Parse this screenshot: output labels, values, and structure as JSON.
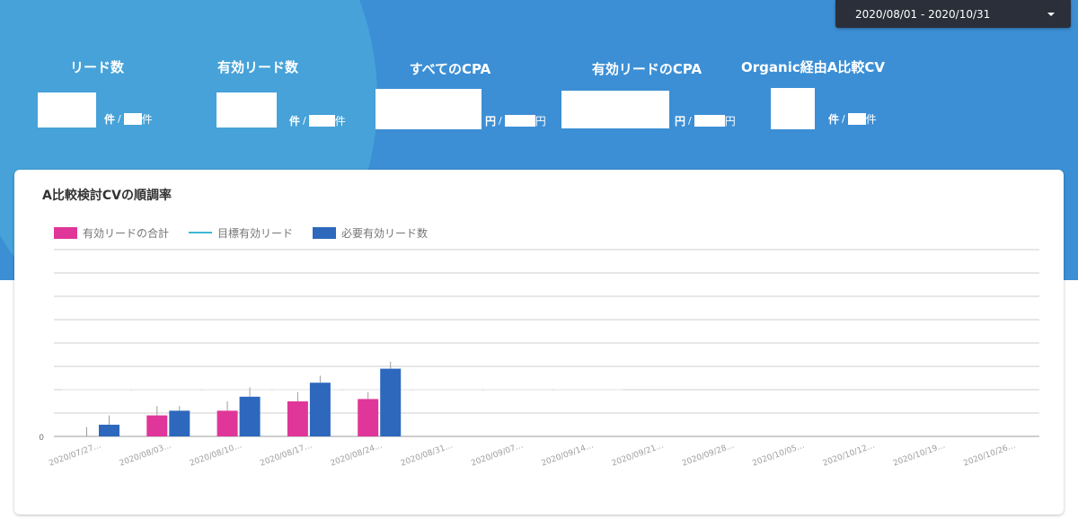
{
  "header": {
    "date_range": "2020/08/01 - 2020/10/31"
  },
  "metrics": [
    {
      "title": "リード数",
      "unit": "件",
      "sep": "/",
      "unit2": "件"
    },
    {
      "title": "有効リード数",
      "unit": "件",
      "sep": "/",
      "unit2": "件"
    },
    {
      "title": "すべてのCPA",
      "unit": "円",
      "sep": "/",
      "unit2": "円"
    },
    {
      "title": "有効リードのCPA",
      "unit": "円",
      "sep": "/",
      "unit2": "円"
    },
    {
      "title": "Organic経由A比較CV",
      "unit": "件",
      "sep": "/",
      "unit2": "件"
    }
  ],
  "colors": {
    "hero": "#3c8fd5",
    "hero_blob": "#46a2d8",
    "series_total": "#e0369a",
    "series_target": "#3db7d6",
    "series_required": "#2d68bd"
  },
  "chart_data": {
    "type": "bar",
    "title": "A比較検討CVの順調率",
    "categories": [
      "2020/07/27…",
      "2020/08/03…",
      "2020/08/10…",
      "2020/08/17…",
      "2020/08/24…",
      "2020/08/31…",
      "2020/09/07…",
      "2020/09/14…",
      "2020/09/21…",
      "2020/09/28…",
      "2020/10/05…",
      "2020/10/12…",
      "2020/10/19…",
      "2020/10/26…"
    ],
    "series": [
      {
        "name": "有効リードの合計",
        "kind": "bar",
        "values": [
          0,
          9,
          11,
          15,
          16,
          null,
          null,
          null,
          null,
          null,
          null,
          null,
          null,
          null
        ]
      },
      {
        "name": "目標有効リード",
        "kind": "line",
        "values": [
          20,
          20,
          20,
          20,
          20,
          20,
          20,
          20,
          null,
          null,
          null,
          null,
          null,
          null
        ]
      },
      {
        "name": "必要有効リード数",
        "kind": "bar",
        "values": [
          5,
          11,
          17,
          23,
          29,
          null,
          null,
          null,
          null,
          null,
          null,
          null,
          null,
          null
        ]
      }
    ],
    "error_bars": {
      "total_high": [
        4,
        13,
        15,
        19,
        19,
        null,
        null,
        null,
        null,
        null,
        null,
        null,
        null,
        null
      ],
      "required_high": [
        9,
        13,
        21,
        26,
        32,
        null,
        null,
        null,
        null,
        null,
        null,
        null,
        null,
        null
      ]
    },
    "y_tick_labels": [
      "0"
    ],
    "ylim": [
      0,
      80
    ],
    "grid": true,
    "legend_position": "top-left"
  }
}
